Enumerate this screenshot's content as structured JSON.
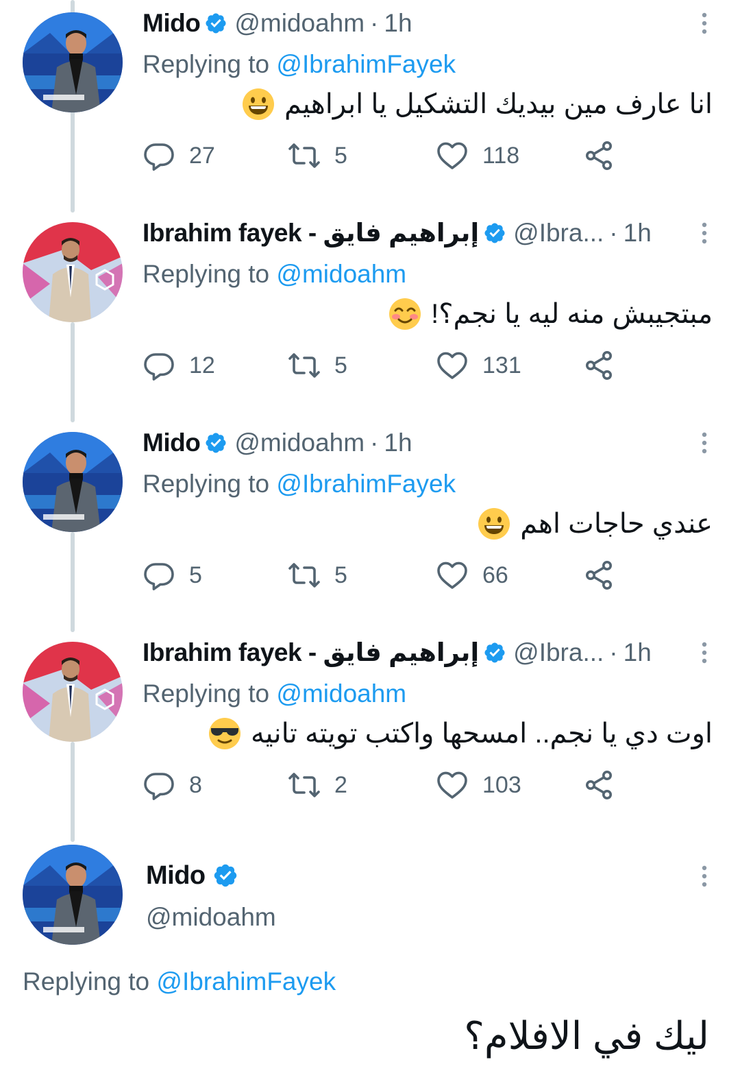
{
  "tweets": [
    {
      "name": "Mido",
      "handle": "@midoahm",
      "dot": "·",
      "time": "1h",
      "replying_prefix": "Replying to ",
      "replying_to": "@IbrahimFayek",
      "text": "انا عارف مين بيديك التشكيل يا ابراهيم",
      "emoji": "grinning-face",
      "replies": "27",
      "retweets": "5",
      "likes": "118",
      "avatar": "mido"
    },
    {
      "name": "Ibrahim fayek - إبراهيم فايق",
      "handle": "@Ibra...",
      "dot": "·",
      "time": "1h",
      "replying_prefix": "Replying to ",
      "replying_to": "@midoahm",
      "text": "مبتجيبش منه ليه يا نجم؟!",
      "emoji": "smiling-face-with-smiling-eyes",
      "replies": "12",
      "retweets": "5",
      "likes": "131",
      "avatar": "ibrahim"
    },
    {
      "name": "Mido",
      "handle": "@midoahm",
      "dot": "·",
      "time": "1h",
      "replying_prefix": "Replying to ",
      "replying_to": "@IbrahimFayek",
      "text": "عندي حاجات اهم",
      "emoji": "grinning-face",
      "replies": "5",
      "retweets": "5",
      "likes": "66",
      "avatar": "mido"
    },
    {
      "name": "Ibrahim fayek - إبراهيم فايق",
      "handle": "@Ibra...",
      "dot": "·",
      "time": "1h",
      "replying_prefix": "Replying to ",
      "replying_to": "@midoahm",
      "text": "اوت دي يا نجم.. امسحها واكتب تويته تانيه",
      "emoji": "smiling-face-with-sunglasses",
      "replies": "8",
      "retweets": "2",
      "likes": "103",
      "avatar": "ibrahim"
    }
  ],
  "focus_tweet": {
    "name": "Mido",
    "handle": "@midoahm",
    "replying_prefix": "Replying to ",
    "replying_to": "@IbrahimFayek",
    "text": "ليك في الافلام؟",
    "avatar": "mido"
  },
  "colors": {
    "accent": "#1d9bf0",
    "secondary_text": "#536471",
    "thread_line": "#cfd9de",
    "primary_text": "#0f1419"
  },
  "icons": [
    "verified-badge-icon",
    "more-icon",
    "reply-icon",
    "retweet-icon",
    "like-icon",
    "share-icon"
  ]
}
